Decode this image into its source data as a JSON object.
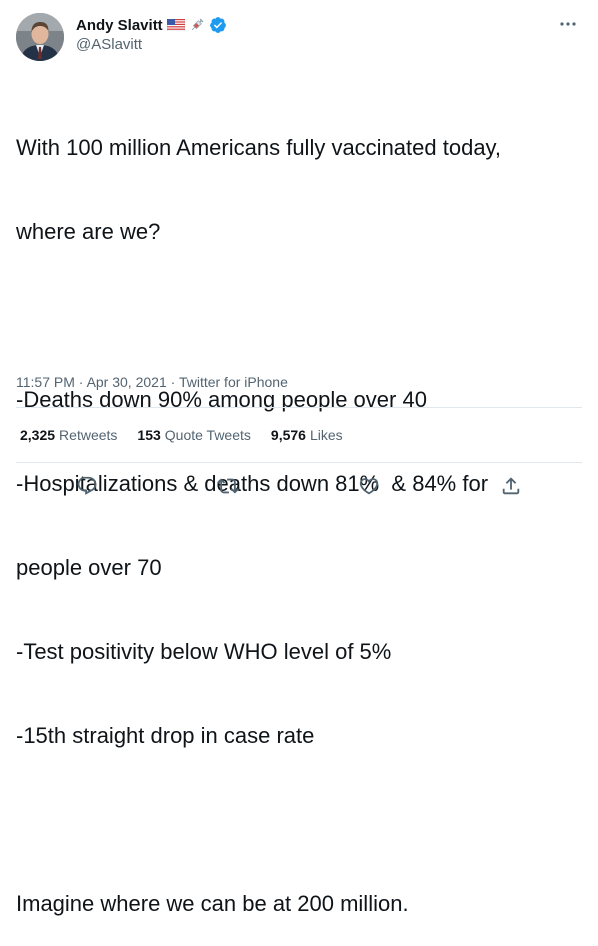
{
  "author": {
    "display_name": "Andy Slavitt",
    "handle": "@ASlavitt",
    "verified": true,
    "name_emojis": [
      "us-flag-icon",
      "syringe-icon"
    ]
  },
  "tweet": {
    "lines": [
      "With 100 million Americans fully vaccinated today,",
      "where are we?",
      "",
      "-Deaths down 90% among people over 40",
      "-Hospitalizations & deaths down 81%  & 84% for",
      "people over 70",
      "-Test positivity below WHO level of 5%",
      "-15th straight drop in case rate",
      "",
      "Imagine where we can be at 200 million."
    ],
    "time": "11:57 PM",
    "date": "Apr 30, 2021",
    "source": "Twitter for iPhone",
    "separator": "·"
  },
  "stats": {
    "retweets_count": "2,325",
    "retweets_label": "Retweets",
    "quotes_count": "153",
    "quotes_label": "Quote Tweets",
    "likes_count": "9,576",
    "likes_label": "Likes"
  },
  "colors": {
    "text": "#0f1419",
    "secondary": "#536471",
    "divider": "#e1e8ed",
    "verified": "#1d9bf0",
    "icon": "#536471"
  },
  "icons": {
    "more": "more-dots-icon",
    "reply": "reply-icon",
    "retweet": "retweet-icon",
    "like": "heart-icon",
    "share": "share-icon"
  }
}
